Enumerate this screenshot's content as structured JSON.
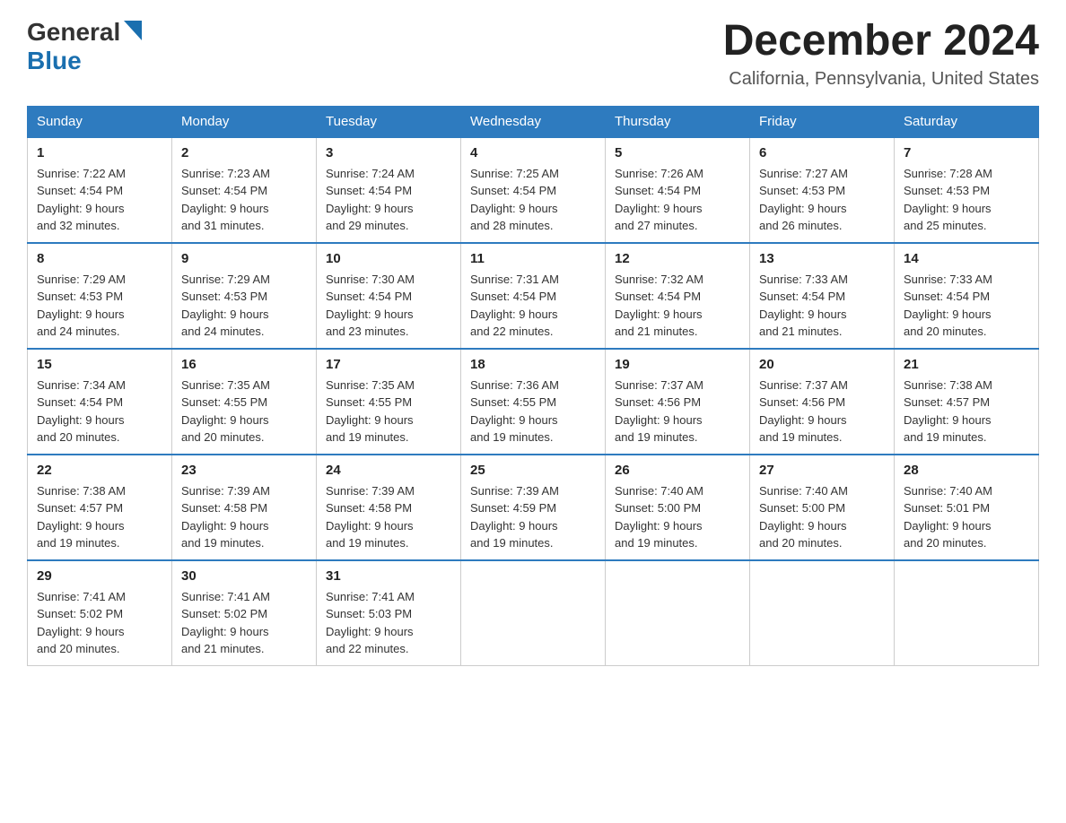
{
  "header": {
    "logo_general": "General",
    "logo_blue": "Blue",
    "month_title": "December 2024",
    "location": "California, Pennsylvania, United States"
  },
  "weekdays": [
    "Sunday",
    "Monday",
    "Tuesday",
    "Wednesday",
    "Thursday",
    "Friday",
    "Saturday"
  ],
  "weeks": [
    [
      {
        "day": "1",
        "sunrise": "7:22 AM",
        "sunset": "4:54 PM",
        "daylight": "9 hours and 32 minutes."
      },
      {
        "day": "2",
        "sunrise": "7:23 AM",
        "sunset": "4:54 PM",
        "daylight": "9 hours and 31 minutes."
      },
      {
        "day": "3",
        "sunrise": "7:24 AM",
        "sunset": "4:54 PM",
        "daylight": "9 hours and 29 minutes."
      },
      {
        "day": "4",
        "sunrise": "7:25 AM",
        "sunset": "4:54 PM",
        "daylight": "9 hours and 28 minutes."
      },
      {
        "day": "5",
        "sunrise": "7:26 AM",
        "sunset": "4:54 PM",
        "daylight": "9 hours and 27 minutes."
      },
      {
        "day": "6",
        "sunrise": "7:27 AM",
        "sunset": "4:53 PM",
        "daylight": "9 hours and 26 minutes."
      },
      {
        "day": "7",
        "sunrise": "7:28 AM",
        "sunset": "4:53 PM",
        "daylight": "9 hours and 25 minutes."
      }
    ],
    [
      {
        "day": "8",
        "sunrise": "7:29 AM",
        "sunset": "4:53 PM",
        "daylight": "9 hours and 24 minutes."
      },
      {
        "day": "9",
        "sunrise": "7:29 AM",
        "sunset": "4:53 PM",
        "daylight": "9 hours and 24 minutes."
      },
      {
        "day": "10",
        "sunrise": "7:30 AM",
        "sunset": "4:54 PM",
        "daylight": "9 hours and 23 minutes."
      },
      {
        "day": "11",
        "sunrise": "7:31 AM",
        "sunset": "4:54 PM",
        "daylight": "9 hours and 22 minutes."
      },
      {
        "day": "12",
        "sunrise": "7:32 AM",
        "sunset": "4:54 PM",
        "daylight": "9 hours and 21 minutes."
      },
      {
        "day": "13",
        "sunrise": "7:33 AM",
        "sunset": "4:54 PM",
        "daylight": "9 hours and 21 minutes."
      },
      {
        "day": "14",
        "sunrise": "7:33 AM",
        "sunset": "4:54 PM",
        "daylight": "9 hours and 20 minutes."
      }
    ],
    [
      {
        "day": "15",
        "sunrise": "7:34 AM",
        "sunset": "4:54 PM",
        "daylight": "9 hours and 20 minutes."
      },
      {
        "day": "16",
        "sunrise": "7:35 AM",
        "sunset": "4:55 PM",
        "daylight": "9 hours and 20 minutes."
      },
      {
        "day": "17",
        "sunrise": "7:35 AM",
        "sunset": "4:55 PM",
        "daylight": "9 hours and 19 minutes."
      },
      {
        "day": "18",
        "sunrise": "7:36 AM",
        "sunset": "4:55 PM",
        "daylight": "9 hours and 19 minutes."
      },
      {
        "day": "19",
        "sunrise": "7:37 AM",
        "sunset": "4:56 PM",
        "daylight": "9 hours and 19 minutes."
      },
      {
        "day": "20",
        "sunrise": "7:37 AM",
        "sunset": "4:56 PM",
        "daylight": "9 hours and 19 minutes."
      },
      {
        "day": "21",
        "sunrise": "7:38 AM",
        "sunset": "4:57 PM",
        "daylight": "9 hours and 19 minutes."
      }
    ],
    [
      {
        "day": "22",
        "sunrise": "7:38 AM",
        "sunset": "4:57 PM",
        "daylight": "9 hours and 19 minutes."
      },
      {
        "day": "23",
        "sunrise": "7:39 AM",
        "sunset": "4:58 PM",
        "daylight": "9 hours and 19 minutes."
      },
      {
        "day": "24",
        "sunrise": "7:39 AM",
        "sunset": "4:58 PM",
        "daylight": "9 hours and 19 minutes."
      },
      {
        "day": "25",
        "sunrise": "7:39 AM",
        "sunset": "4:59 PM",
        "daylight": "9 hours and 19 minutes."
      },
      {
        "day": "26",
        "sunrise": "7:40 AM",
        "sunset": "5:00 PM",
        "daylight": "9 hours and 19 minutes."
      },
      {
        "day": "27",
        "sunrise": "7:40 AM",
        "sunset": "5:00 PM",
        "daylight": "9 hours and 20 minutes."
      },
      {
        "day": "28",
        "sunrise": "7:40 AM",
        "sunset": "5:01 PM",
        "daylight": "9 hours and 20 minutes."
      }
    ],
    [
      {
        "day": "29",
        "sunrise": "7:41 AM",
        "sunset": "5:02 PM",
        "daylight": "9 hours and 20 minutes."
      },
      {
        "day": "30",
        "sunrise": "7:41 AM",
        "sunset": "5:02 PM",
        "daylight": "9 hours and 21 minutes."
      },
      {
        "day": "31",
        "sunrise": "7:41 AM",
        "sunset": "5:03 PM",
        "daylight": "9 hours and 22 minutes."
      },
      null,
      null,
      null,
      null
    ]
  ],
  "labels": {
    "sunrise": "Sunrise:",
    "sunset": "Sunset:",
    "daylight": "Daylight:"
  }
}
